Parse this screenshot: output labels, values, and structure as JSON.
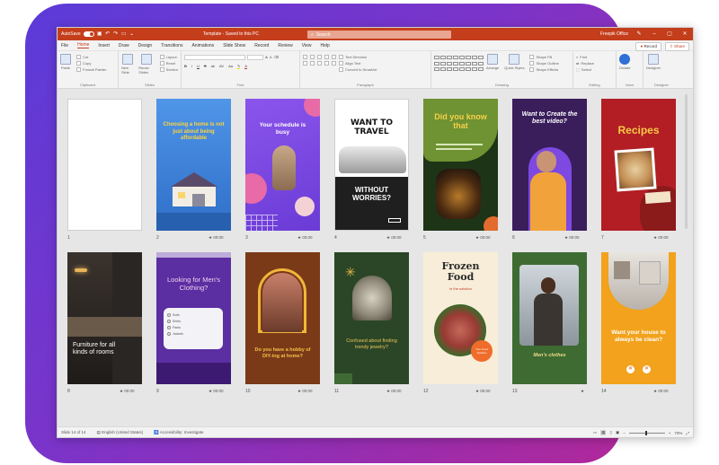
{
  "titlebar": {
    "autosave": "AutoSave",
    "toggle_state": "On",
    "doc_title": "Template - Saved to this PC",
    "search_placeholder": "Search",
    "account": "Freepik Office",
    "accent": "#c43e1c"
  },
  "menu": {
    "tabs": [
      "File",
      "Home",
      "Insert",
      "Draw",
      "Design",
      "Transitions",
      "Animations",
      "Slide Show",
      "Record",
      "Review",
      "View",
      "Help"
    ],
    "active": "Home",
    "record_label": "Record",
    "share_label": "Share"
  },
  "ribbon": {
    "groups": {
      "clipboard": "Clipboard",
      "slides": "Slides",
      "font": "Font",
      "paragraph": "Paragraph",
      "drawing": "Drawing",
      "editing": "Editing",
      "voice": "Voice",
      "designer": "Designer"
    },
    "paste": "Paste",
    "cut": "Cut",
    "copy": "Copy",
    "format_painter": "Format Painter",
    "new_slide": "New Slide",
    "reuse_slides": "Reuse Slides",
    "layout": "Layout",
    "reset": "Reset",
    "section": "Section",
    "text_direction": "Text Direction",
    "align_text": "Align Text",
    "convert_smartart": "Convert to SmartArt",
    "arrange": "Arrange",
    "quick_styles": "Quick Styles",
    "shape_fill": "Shape Fill",
    "shape_outline": "Shape Outline",
    "shape_effects": "Shape Effects",
    "find": "Find",
    "replace": "Replace",
    "select": "Select",
    "dictate": "Dictate",
    "designer": "Designer"
  },
  "slides": [
    {
      "num": "1",
      "time": "",
      "headline": "",
      "bg": "#ffffff"
    },
    {
      "num": "2",
      "time": "00:00",
      "headline": "Choosing a home is not just about being affordable",
      "bg": "#4a8ee0"
    },
    {
      "num": "3",
      "time": "00:00",
      "headline": "Your schedule is busy",
      "bg": "#7a4ee0"
    },
    {
      "num": "4",
      "time": "00:00",
      "headline": "WANT TO TRAVEL",
      "sub": "WITHOUT WORRIES?",
      "bg": "#ffffff"
    },
    {
      "num": "5",
      "time": "00:00",
      "headline": "Did you know that",
      "bg": "#6a8e2e"
    },
    {
      "num": "6",
      "time": "00:00",
      "headline": "Want to Create the best video?",
      "bg": "#3b1f5c"
    },
    {
      "num": "7",
      "time": "00:00",
      "headline": "Recipes",
      "bg": "#b32020"
    },
    {
      "num": "8",
      "time": "00:00",
      "headline": "Furniture for all kinds of rooms",
      "bg": "#2e2a28"
    },
    {
      "num": "9",
      "time": "00:00",
      "headline": "Looking for Men's Clothing?",
      "bg": "#5a2ca0"
    },
    {
      "num": "10",
      "time": "00:00",
      "headline": "Do you have a hobby of DIY-ing at home?",
      "bg": "#7a3a1c"
    },
    {
      "num": "11",
      "time": "00:00",
      "headline": "Confused about finding trendy jewelry?",
      "bg": "#2e4a2a"
    },
    {
      "num": "12",
      "time": "00:00",
      "headline": "Frozen Food",
      "sub": "in the solution",
      "bg": "#f7ecd9"
    },
    {
      "num": "13",
      "time": "",
      "headline": "Men's clothes",
      "bg": "#3e6b32"
    },
    {
      "num": "14",
      "time": "00:00",
      "headline": "Want your house to always be clean?",
      "bg": "#f0a020"
    }
  ],
  "slide9_items": [
    "Suits",
    "Shirts",
    "Pants",
    "Jackets"
  ],
  "slide12_badge": "Your Food Solution",
  "statusbar": {
    "slide_count": "Slide 14 of 14",
    "language": "English (United States)",
    "accessibility": "Accessibility: Investigate",
    "zoom": "70%"
  }
}
